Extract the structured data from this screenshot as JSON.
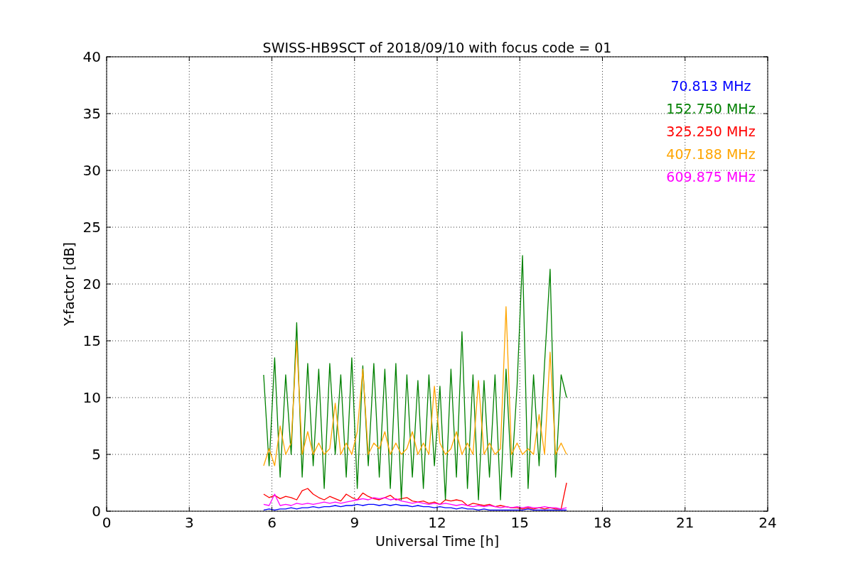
{
  "chart_data": {
    "type": "line",
    "title": "SWISS-HB9SCT of 2018/09/10 with focus code = 01",
    "xlabel": "Universal Time [h]",
    "ylabel": "Y-factor [dB]",
    "grid": true,
    "xlim": [
      0,
      24
    ],
    "ylim": [
      0,
      40
    ],
    "xticks": [
      0,
      3,
      6,
      9,
      12,
      15,
      18,
      21,
      24
    ],
    "yticks": [
      0,
      5,
      10,
      15,
      20,
      25,
      30,
      35,
      40
    ],
    "x": [
      5.7,
      5.9,
      6.1,
      6.3,
      6.5,
      6.7,
      6.9,
      7.1,
      7.3,
      7.5,
      7.7,
      7.9,
      8.1,
      8.3,
      8.5,
      8.7,
      8.9,
      9.1,
      9.3,
      9.5,
      9.7,
      9.9,
      10.1,
      10.3,
      10.5,
      10.7,
      10.9,
      11.1,
      11.3,
      11.5,
      11.7,
      11.9,
      12.1,
      12.3,
      12.5,
      12.7,
      12.9,
      13.1,
      13.3,
      13.5,
      13.7,
      13.9,
      14.1,
      14.3,
      14.5,
      14.7,
      14.9,
      15.1,
      15.3,
      15.5,
      15.7,
      15.9,
      16.1,
      16.3,
      16.5,
      16.7
    ],
    "series": [
      {
        "name": "70.813 MHz",
        "color": "#0000ff",
        "values": [
          0.1,
          0.2,
          0.1,
          0.2,
          0.2,
          0.3,
          0.2,
          0.3,
          0.3,
          0.4,
          0.3,
          0.4,
          0.4,
          0.5,
          0.4,
          0.5,
          0.5,
          0.6,
          0.5,
          0.6,
          0.6,
          0.5,
          0.6,
          0.5,
          0.6,
          0.5,
          0.5,
          0.4,
          0.5,
          0.4,
          0.4,
          0.3,
          0.4,
          0.3,
          0.3,
          0.2,
          0.3,
          0.2,
          0.2,
          0.1,
          0.2,
          0.1,
          0.1,
          0.1,
          0.1,
          0.1,
          0.1,
          0.1,
          0.2,
          0.1,
          0.1,
          0.1,
          0.1,
          0.1,
          0.1,
          0.1
        ]
      },
      {
        "name": "152.750 MHz",
        "color": "#008000",
        "values": [
          12,
          4,
          13.5,
          3,
          12,
          5,
          16.6,
          3,
          13,
          4,
          12.5,
          2,
          13,
          5,
          12,
          3,
          13.5,
          2,
          12.8,
          4,
          13,
          3,
          12.5,
          2,
          13,
          1,
          12,
          3,
          11.5,
          2,
          12,
          4,
          11,
          1,
          12.5,
          3,
          15.8,
          2,
          12,
          1,
          11.5,
          3,
          12,
          1,
          12.5,
          3,
          11,
          22.5,
          2,
          12,
          4,
          13,
          21.3,
          3,
          12,
          10
        ]
      },
      {
        "name": "325.250 MHz",
        "color": "#ff0000",
        "values": [
          1.5,
          1.2,
          1.4,
          1.1,
          1.3,
          1.2,
          1.0,
          1.8,
          2.0,
          1.5,
          1.2,
          1.0,
          1.3,
          1.1,
          0.9,
          1.5,
          1.2,
          1.0,
          1.6,
          1.3,
          1.1,
          1.0,
          1.2,
          1.4,
          1.0,
          1.1,
          1.2,
          0.9,
          0.8,
          0.9,
          0.7,
          0.8,
          0.6,
          1.0,
          0.9,
          1.0,
          0.9,
          0.5,
          0.7,
          0.6,
          0.5,
          0.6,
          0.4,
          0.5,
          0.4,
          0.3,
          0.3,
          0.2,
          0.3,
          0.2,
          0.3,
          0.2,
          0.3,
          0.2,
          0.2,
          2.5
        ]
      },
      {
        "name": "407.188 MHz",
        "color": "#ffa500",
        "values": [
          4,
          5.5,
          4,
          7.5,
          5,
          6,
          15,
          5,
          7,
          5,
          6,
          5,
          5.5,
          9.5,
          5,
          6,
          5,
          7,
          12.5,
          5,
          6,
          5.5,
          7,
          5,
          6,
          5,
          5.5,
          7,
          5,
          6,
          5,
          11,
          6,
          5,
          5.5,
          7,
          5,
          6,
          5,
          11.5,
          5,
          6,
          5,
          5.5,
          18,
          5,
          6,
          5,
          5.5,
          5,
          8.5,
          5,
          14,
          5,
          6,
          5
        ]
      },
      {
        "name": "609.875 MHz",
        "color": "#ff00ff",
        "values": [
          0.6,
          0.5,
          1.5,
          0.5,
          0.6,
          0.5,
          0.7,
          0.6,
          0.7,
          0.6,
          0.7,
          0.8,
          0.7,
          0.8,
          0.7,
          0.8,
          0.9,
          1.0,
          1.1,
          1.0,
          1.2,
          1.1,
          1.2,
          1.0,
          1.1,
          0.9,
          0.8,
          0.7,
          0.8,
          0.7,
          0.6,
          0.7,
          0.6,
          0.7,
          0.6,
          0.5,
          0.6,
          0.5,
          0.4,
          0.5,
          0.4,
          0.5,
          0.4,
          0.3,
          0.4,
          0.3,
          0.4,
          0.3,
          0.4,
          0.3,
          0.3,
          0.4,
          0.3,
          0.3,
          0.2,
          0.3
        ]
      }
    ]
  }
}
